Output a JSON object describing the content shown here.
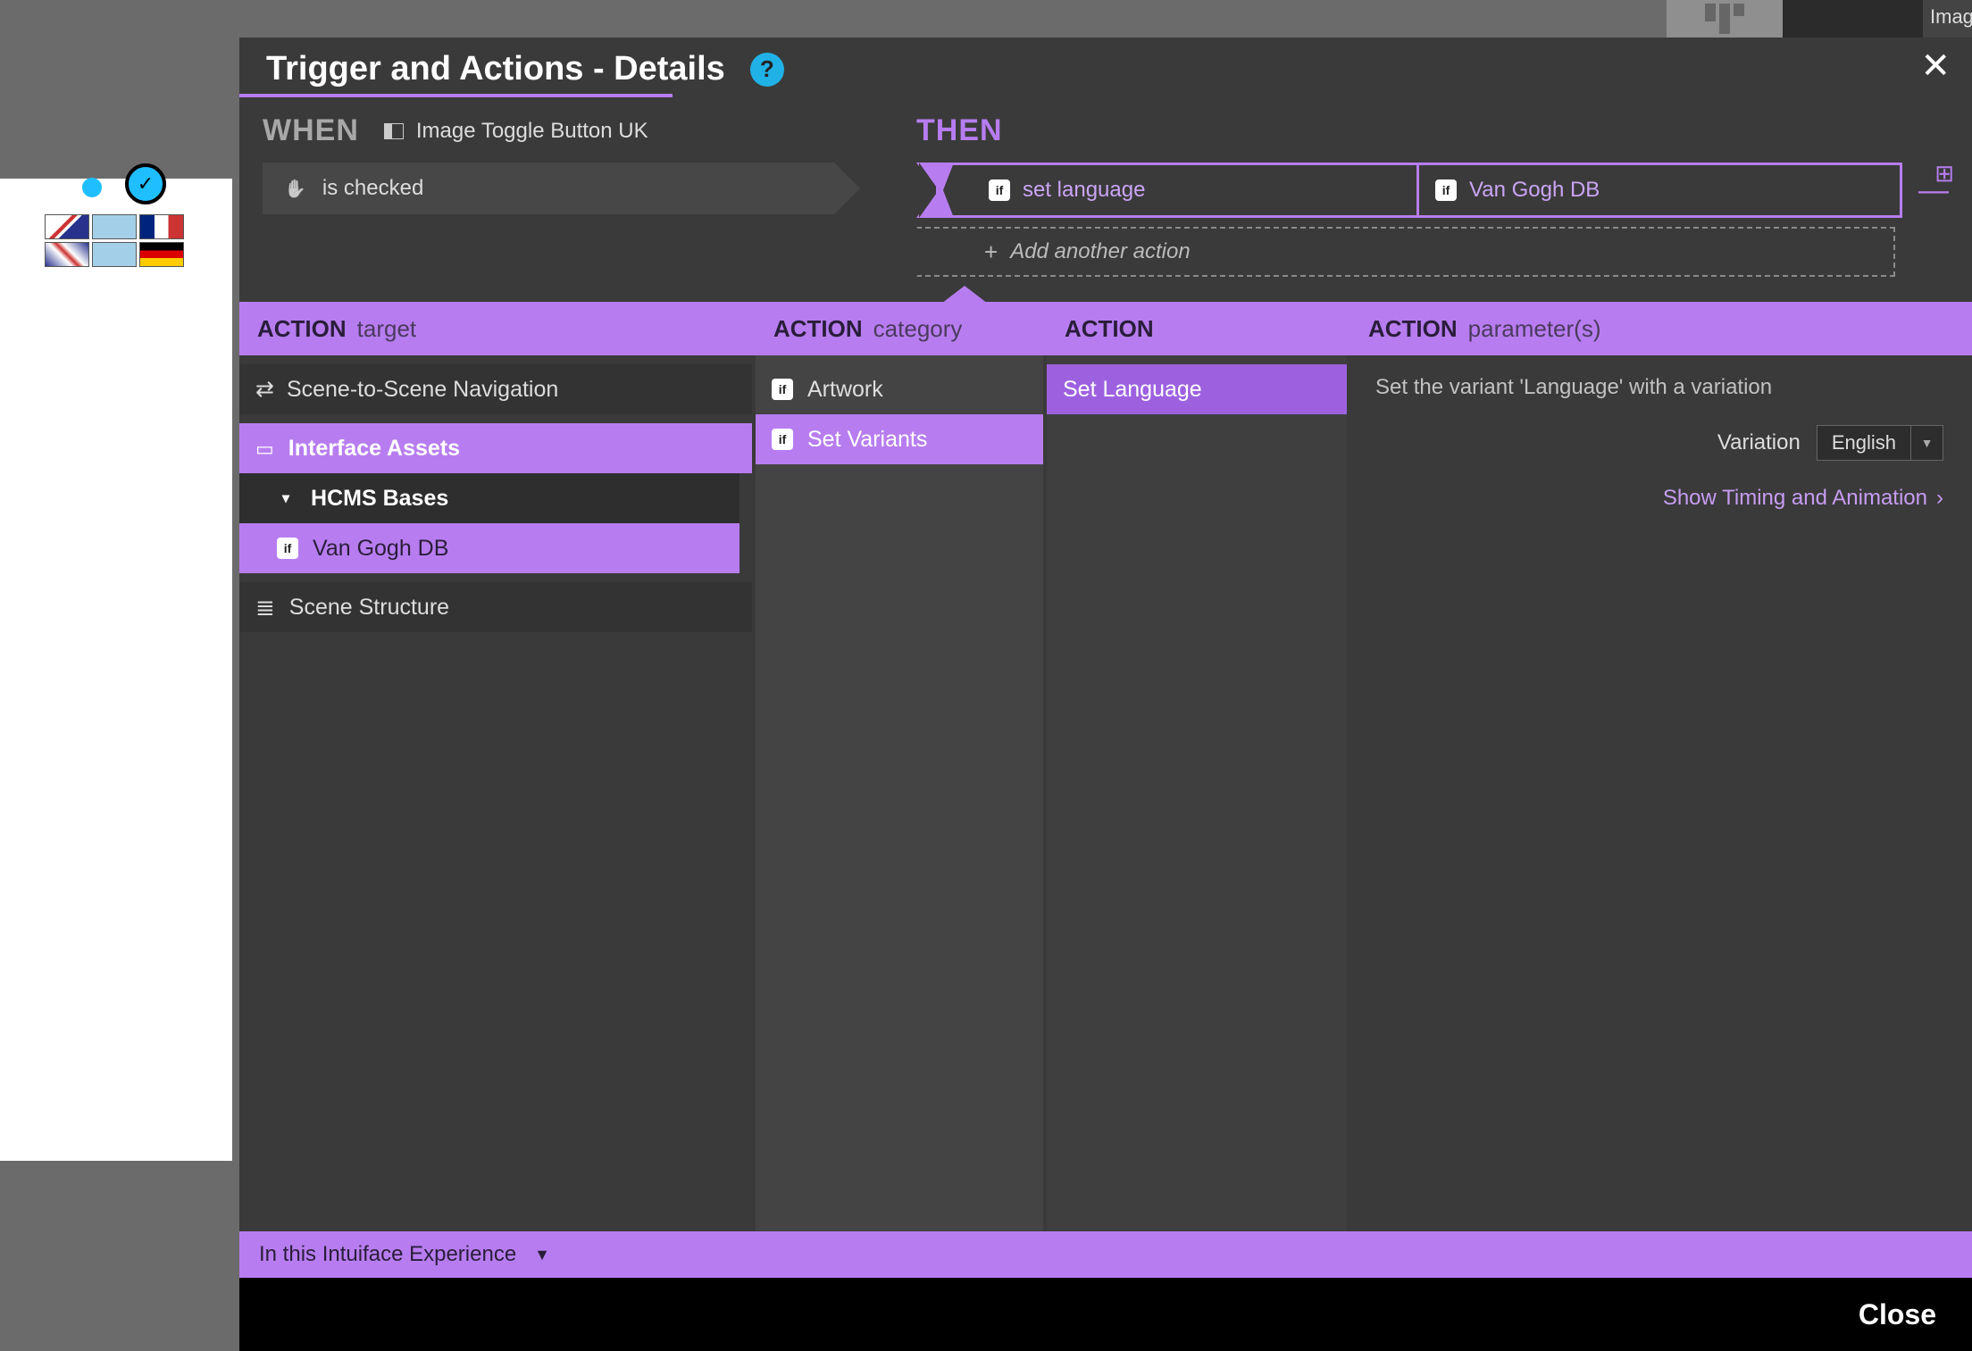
{
  "dialog": {
    "title": "Trigger and Actions - Details",
    "help": "?",
    "close": "✕",
    "grid_icon": "⊞"
  },
  "when": {
    "label": "WHEN",
    "source": "Image Toggle Button UK",
    "trigger": "is checked"
  },
  "then": {
    "label": "THEN",
    "action_name": "set language",
    "action_target": "Van Gogh DB",
    "remove": "—",
    "add_label": "Add another action",
    "add_plus": "+"
  },
  "headers": {
    "action": "ACTION",
    "target": "target",
    "category": "category",
    "params": "parameter(s)"
  },
  "targets": {
    "scene_nav": "Scene-to-Scene Navigation",
    "interface_assets": "Interface Assets",
    "hcms": "HCMS Bases",
    "van_gogh": "Van Gogh DB",
    "scene_structure": "Scene Structure"
  },
  "categories": {
    "artwork": "Artwork",
    "set_variants": "Set Variants"
  },
  "actions": {
    "set_language": "Set Language"
  },
  "parameters": {
    "desc": "Set the variant 'Language' with a variation",
    "variation_label": "Variation",
    "variation_value": "English",
    "timing": "Show Timing and Animation"
  },
  "scope": {
    "label": "In this Intuiface Experience"
  },
  "footer": {
    "close": "Close"
  },
  "top_tab_cutoff": "Imag"
}
